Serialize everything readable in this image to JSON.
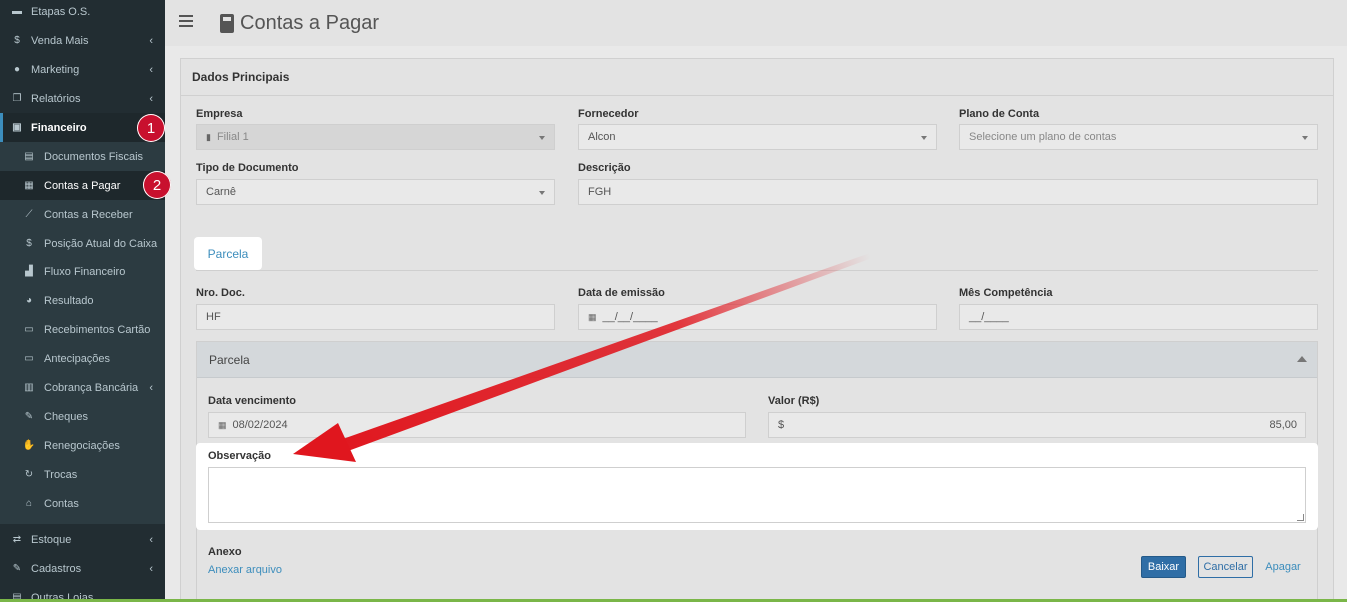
{
  "sidebar": {
    "items": [
      {
        "label": "Etapas O.S.",
        "icon": "list-icon"
      },
      {
        "label": "Venda Mais",
        "icon": "dollar-icon"
      },
      {
        "label": "Marketing",
        "icon": "comments-icon"
      },
      {
        "label": "Relatórios",
        "icon": "copy-icon"
      },
      {
        "label": "Financeiro",
        "icon": "money-icon"
      },
      {
        "label": "Documentos Fiscais",
        "icon": "file-icon"
      },
      {
        "label": "Contas a Pagar",
        "icon": "calculator-icon"
      },
      {
        "label": "Contas a Receber",
        "icon": "line-chart-icon"
      },
      {
        "label": "Posição Atual do Caixa",
        "icon": "dollar-icon"
      },
      {
        "label": "Fluxo Financeiro",
        "icon": "bar-chart-icon"
      },
      {
        "label": "Resultado",
        "icon": "pie-chart-icon"
      },
      {
        "label": "Recebimentos Cartão",
        "icon": "credit-card-icon"
      },
      {
        "label": "Antecipações",
        "icon": "credit-card-icon"
      },
      {
        "label": "Cobrança Bancária",
        "icon": "barcode-icon"
      },
      {
        "label": "Cheques",
        "icon": "edit-icon"
      },
      {
        "label": "Renegociações",
        "icon": "handshake-icon"
      },
      {
        "label": "Trocas",
        "icon": "refresh-icon"
      },
      {
        "label": "Contas",
        "icon": "bank-icon"
      },
      {
        "label": "Estoque",
        "icon": "exchange-icon"
      },
      {
        "label": "Cadastros",
        "icon": "edit-icon"
      },
      {
        "label": "Outras Lojas",
        "icon": "file-icon"
      }
    ],
    "badge1": "1",
    "badge2": "2"
  },
  "header": {
    "title": "Contas a Pagar"
  },
  "card": {
    "title": "Dados Principais",
    "empresa_label": "Empresa",
    "empresa_value": "Filial 1",
    "fornecedor_label": "Fornecedor",
    "fornecedor_value": "Alcon",
    "plano_label": "Plano de Conta",
    "plano_placeholder": "Selecione um plano de contas",
    "tipo_label": "Tipo de Documento",
    "tipo_value": "Carnê",
    "descricao_label": "Descrição",
    "descricao_value": "FGH",
    "tab_label": "Parcela",
    "nro_label": "Nro. Doc.",
    "nro_value": "HF",
    "emissao_label": "Data de emissão",
    "emissao_value": "__/__/____",
    "mes_label": "Mês Competência",
    "mes_value": "__/____"
  },
  "parcela": {
    "title": "Parcela",
    "venc_label": "Data vencimento",
    "venc_value": "08/02/2024",
    "valor_label": "Valor (R$)",
    "valor_prefix": "$",
    "valor_value": "85,00",
    "obs_label": "Observação",
    "anexo_label": "Anexo",
    "anexar_link": "Anexar arquivo",
    "baixar": "Baixar",
    "cancelar": "Cancelar",
    "apagar": "Apagar"
  },
  "colors": {
    "sidebar": "#222d32",
    "accent": "#3c8dbc",
    "badge": "#c8102e",
    "arrow": "#e0161e"
  }
}
